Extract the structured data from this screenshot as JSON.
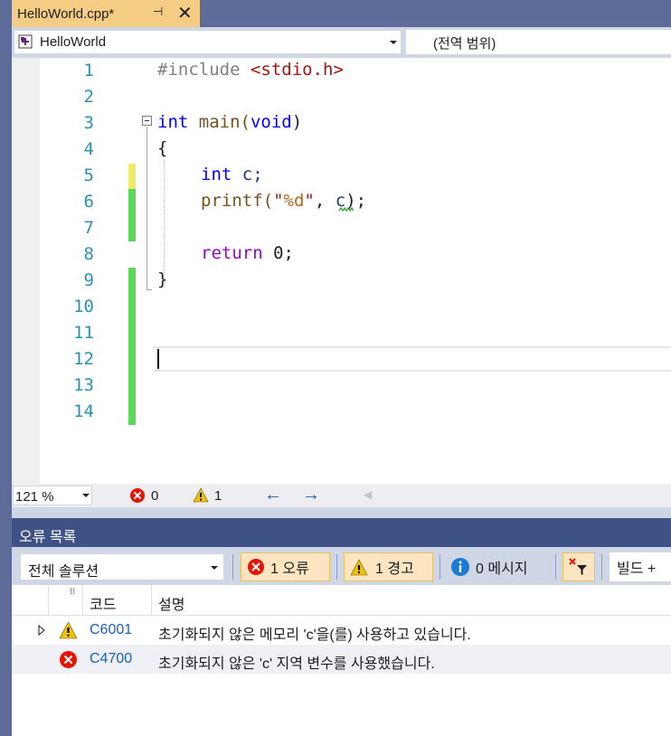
{
  "tab": {
    "title": "HelloWorld.cpp*",
    "pin_glyph": "⊣",
    "close_glyph": "✕"
  },
  "navbar": {
    "project": "HelloWorld",
    "scope": "(전역 범위)"
  },
  "editor": {
    "line_numbers": [
      "1",
      "2",
      "3",
      "4",
      "5",
      "6",
      "7",
      "8",
      "9",
      "10",
      "11",
      "12",
      "13",
      "14"
    ],
    "code": {
      "l1_directive": "#include ",
      "l1_header": "<stdio.h>",
      "l3_kw": "int",
      "l3_fn": " main(",
      "l3_void": "void",
      "l3_close": ")",
      "l4": "{",
      "l5_kw": "int",
      "l5_rest": " c;",
      "l6_fn": "printf(",
      "l6_quote1": "\"",
      "l6_fmt": "%d",
      "l6_quote2": "\"",
      "l6_comma": ", ",
      "l6_var": "c",
      "l6_end": ");",
      "l8_kw": "return",
      "l8_rest": " 0;",
      "l9": "}"
    },
    "change_marks": {
      "saved_color": "#5bd75b",
      "unsaved_color": "#f2ea6b"
    }
  },
  "status": {
    "zoom": "121 %",
    "errors": "0",
    "warnings": "1",
    "back_arrow": "←",
    "forward_arrow": "→",
    "left_marker": "◀"
  },
  "error_list": {
    "title": "오류 목록",
    "scope": "전체 솔루션",
    "errors_btn": "1 오류",
    "warnings_btn": "1 경고",
    "messages_btn": "0 메시지",
    "build_btn": "빌드 +",
    "columns": {
      "code": "코드",
      "description": "설명"
    },
    "rows": [
      {
        "code": "C6001",
        "description": "초기화되지 않은 메모리 'c'을(를) 사용하고 있습니다.",
        "type": "warning"
      },
      {
        "code": "C4700",
        "description": "초기화되지 않은 'c' 지역 변수를 사용했습니다.",
        "type": "error"
      }
    ]
  },
  "colors": {
    "accent": "#3e5286",
    "tab_active": "#f5cc84",
    "error": "#e51400",
    "warning": "#f2c200"
  }
}
